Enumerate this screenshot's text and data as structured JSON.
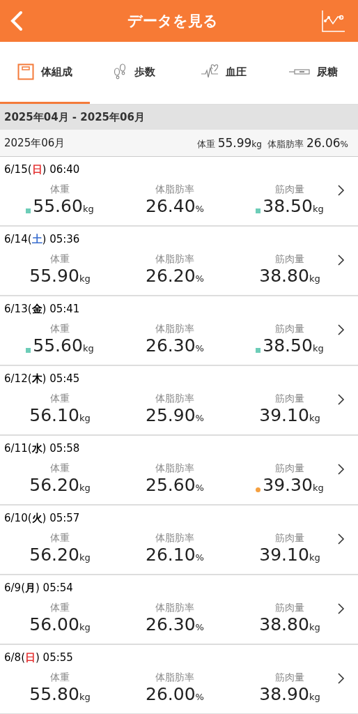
{
  "header": {
    "title": "データを見る"
  },
  "tabs": [
    {
      "label": "体組成",
      "selected": true
    },
    {
      "label": "歩数",
      "selected": false
    },
    {
      "label": "血圧",
      "selected": false
    },
    {
      "label": "尿糖",
      "selected": false
    }
  ],
  "period": "2025年04月 - 2025年06月",
  "month_summary": {
    "month": "2025年06月",
    "items": [
      {
        "label": "体重",
        "value": "55.99",
        "unit": "kg"
      },
      {
        "label": "体脂肪率",
        "value": "26.06",
        "unit": "%"
      }
    ]
  },
  "entries": [
    {
      "date": "6/15(",
      "weekday": "日",
      "color": "#e53535",
      "rest": ") 06:40",
      "metrics": [
        {
          "label": "体重",
          "value": "55.60",
          "unit": "kg",
          "marker": {
            "kind": "square",
            "color": "#6dcdb8"
          }
        },
        {
          "label": "体脂肪率",
          "value": "26.40",
          "unit": "%"
        },
        {
          "label": "筋肉量",
          "value": "38.50",
          "unit": "kg",
          "marker": {
            "kind": "square",
            "color": "#6dcdb8"
          }
        }
      ]
    },
    {
      "date": "6/14(",
      "weekday": "土",
      "color": "#3b6fd0",
      "rest": ") 05:36",
      "metrics": [
        {
          "label": "体重",
          "value": "55.90",
          "unit": "kg"
        },
        {
          "label": "体脂肪率",
          "value": "26.20",
          "unit": "%"
        },
        {
          "label": "筋肉量",
          "value": "38.80",
          "unit": "kg"
        }
      ]
    },
    {
      "date": "6/13(",
      "weekday": "金",
      "color": "#000000",
      "rest": ") 05:41",
      "metrics": [
        {
          "label": "体重",
          "value": "55.60",
          "unit": "kg",
          "marker": {
            "kind": "square",
            "color": "#6dcdb8"
          }
        },
        {
          "label": "体脂肪率",
          "value": "26.30",
          "unit": "%"
        },
        {
          "label": "筋肉量",
          "value": "38.50",
          "unit": "kg",
          "marker": {
            "kind": "square",
            "color": "#6dcdb8"
          }
        }
      ]
    },
    {
      "date": "6/12(",
      "weekday": "木",
      "color": "#000000",
      "rest": ") 05:45",
      "metrics": [
        {
          "label": "体重",
          "value": "56.10",
          "unit": "kg"
        },
        {
          "label": "体脂肪率",
          "value": "25.90",
          "unit": "%"
        },
        {
          "label": "筋肉量",
          "value": "39.10",
          "unit": "kg"
        }
      ]
    },
    {
      "date": "6/11(",
      "weekday": "水",
      "color": "#000000",
      "rest": ") 05:58",
      "metrics": [
        {
          "label": "体重",
          "value": "56.20",
          "unit": "kg"
        },
        {
          "label": "体脂肪率",
          "value": "25.60",
          "unit": "%"
        },
        {
          "label": "筋肉量",
          "value": "39.30",
          "unit": "kg",
          "marker": {
            "kind": "dot",
            "color": "#f5a040"
          }
        }
      ]
    },
    {
      "date": "6/10(",
      "weekday": "火",
      "color": "#000000",
      "rest": ") 05:57",
      "metrics": [
        {
          "label": "体重",
          "value": "56.20",
          "unit": "kg"
        },
        {
          "label": "体脂肪率",
          "value": "26.10",
          "unit": "%"
        },
        {
          "label": "筋肉量",
          "value": "39.10",
          "unit": "kg"
        }
      ]
    },
    {
      "date": "6/9(",
      "weekday": "月",
      "color": "#000000",
      "rest": ") 05:54",
      "metrics": [
        {
          "label": "体重",
          "value": "56.00",
          "unit": "kg"
        },
        {
          "label": "体脂肪率",
          "value": "26.30",
          "unit": "%"
        },
        {
          "label": "筋肉量",
          "value": "38.80",
          "unit": "kg"
        }
      ]
    },
    {
      "date": "6/8(",
      "weekday": "日",
      "color": "#e53535",
      "rest": ") 05:55",
      "metrics": [
        {
          "label": "体重",
          "value": "55.80",
          "unit": "kg"
        },
        {
          "label": "体脂肪率",
          "value": "26.00",
          "unit": "%"
        },
        {
          "label": "筋肉量",
          "value": "38.90",
          "unit": "kg"
        }
      ]
    }
  ]
}
